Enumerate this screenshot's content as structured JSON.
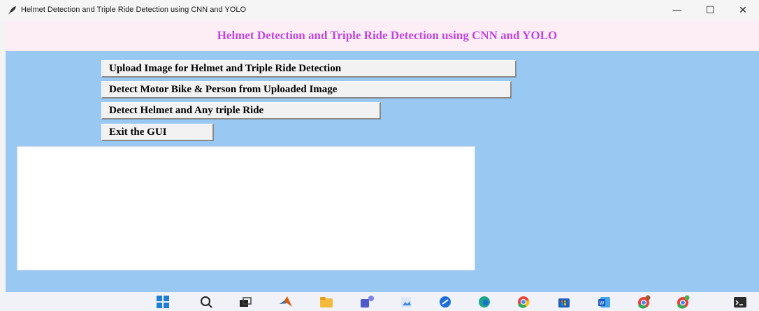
{
  "window": {
    "title": "Helmet Detection and Triple Ride Detection using CNN and YOLO",
    "controls": {
      "minimize": "—",
      "maximize": "☐",
      "close": "✕"
    }
  },
  "header": {
    "title": "Helmet Detection and Triple Ride Detection using CNN and YOLO",
    "background": "#fdeef6",
    "title_color": "#c046e0"
  },
  "main": {
    "background": "#99c9f2",
    "buttons": [
      {
        "label": "Upload Image for Helmet and Triple Ride Detection"
      },
      {
        "label": "Detect Motor Bike & Person from Uploaded Image"
      },
      {
        "label": "Detect Helmet and Any triple Ride"
      },
      {
        "label": "Exit the GUI"
      }
    ]
  },
  "taskbar": {
    "icons": [
      "windows-start-icon",
      "search-icon",
      "task-view-icon",
      "matlab-icon",
      "file-explorer-icon",
      "teams-icon",
      "image-viewer-icon",
      "browser-icon",
      "edge-icon",
      "chrome-icon",
      "store-icon",
      "word-icon",
      "chrome-profile-icon",
      "chrome-profile-icon-2",
      "terminal-icon"
    ]
  }
}
